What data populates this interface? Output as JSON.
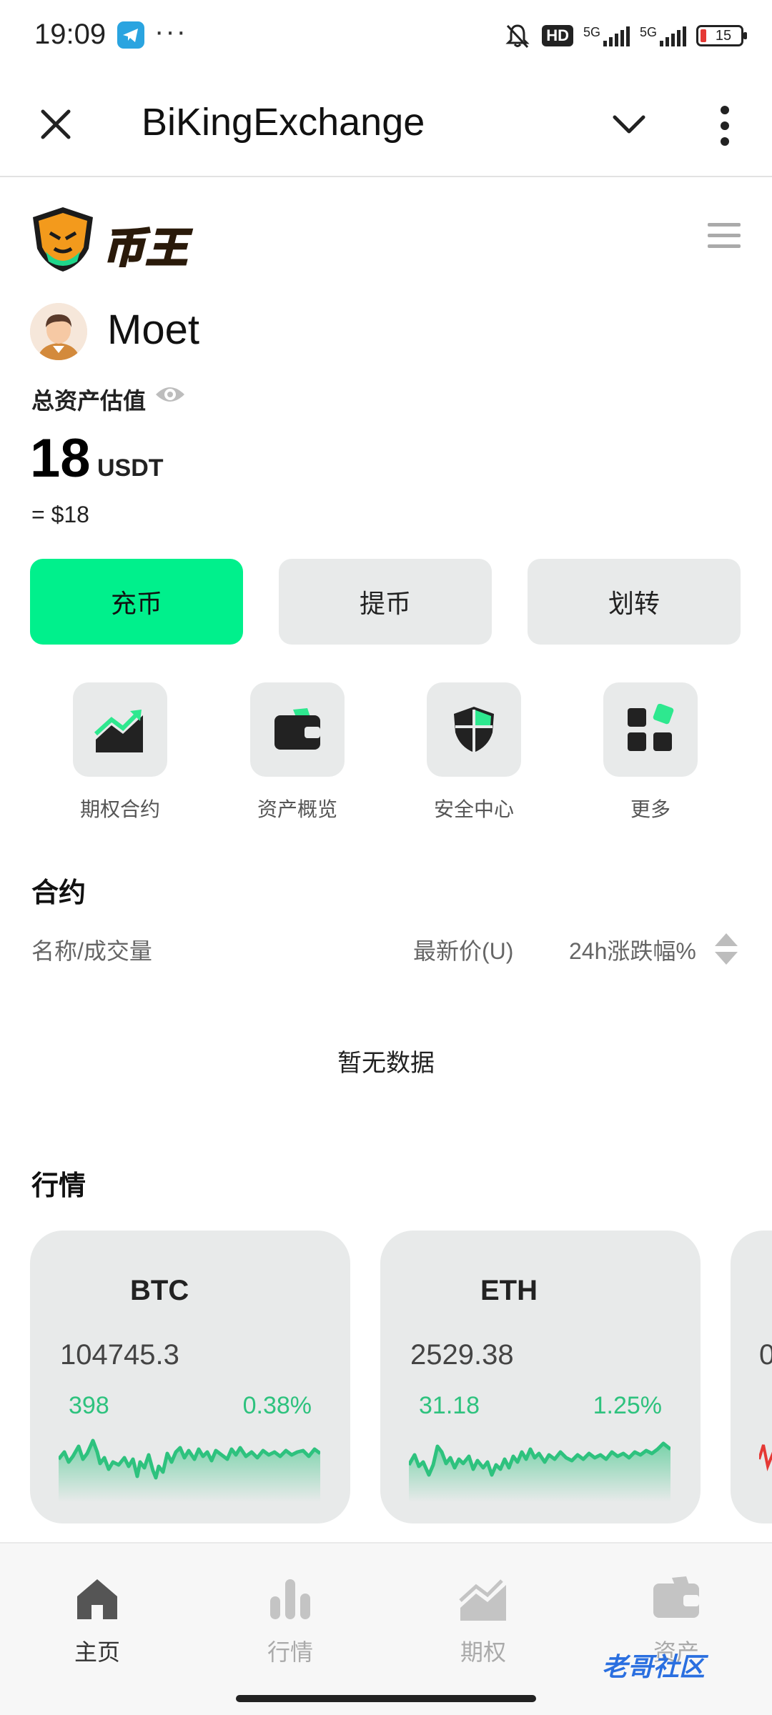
{
  "status": {
    "time": "19:09",
    "battery": "15",
    "hd": "HD",
    "net1": "5G",
    "net2": "5G"
  },
  "appbar": {
    "title": "BiKingExchange"
  },
  "brand": {
    "logo_text": "币王"
  },
  "user": {
    "name": "Moet"
  },
  "assets": {
    "label": "总资产估值",
    "total": "18",
    "unit": "USDT",
    "usd": "= $18"
  },
  "actions": {
    "deposit": "充币",
    "withdraw": "提币",
    "transfer": "划转"
  },
  "quick": {
    "options": "期权合约",
    "overview": "资产概览",
    "security": "安全中心",
    "more": "更多"
  },
  "contracts": {
    "title": "合约",
    "col_name": "名称/成交量",
    "col_price": "最新价(U)",
    "col_change": "24h涨跌幅%",
    "empty": "暂无数据"
  },
  "market": {
    "title": "行情",
    "cards": [
      {
        "symbol": "BTC",
        "price": "104745.3",
        "change": "398",
        "percent": "0.38%"
      },
      {
        "symbol": "ETH",
        "price": "2529.38",
        "change": "31.18",
        "percent": "1.25%"
      },
      {
        "price": "0"
      }
    ]
  },
  "nav": {
    "home": "主页",
    "market": "行情",
    "options": "期权",
    "assets": "资产"
  },
  "watermark": "老哥社区",
  "colors": {
    "accent": "#00f08c",
    "up": "#2ec27e",
    "card_bg": "#e8eaea"
  }
}
